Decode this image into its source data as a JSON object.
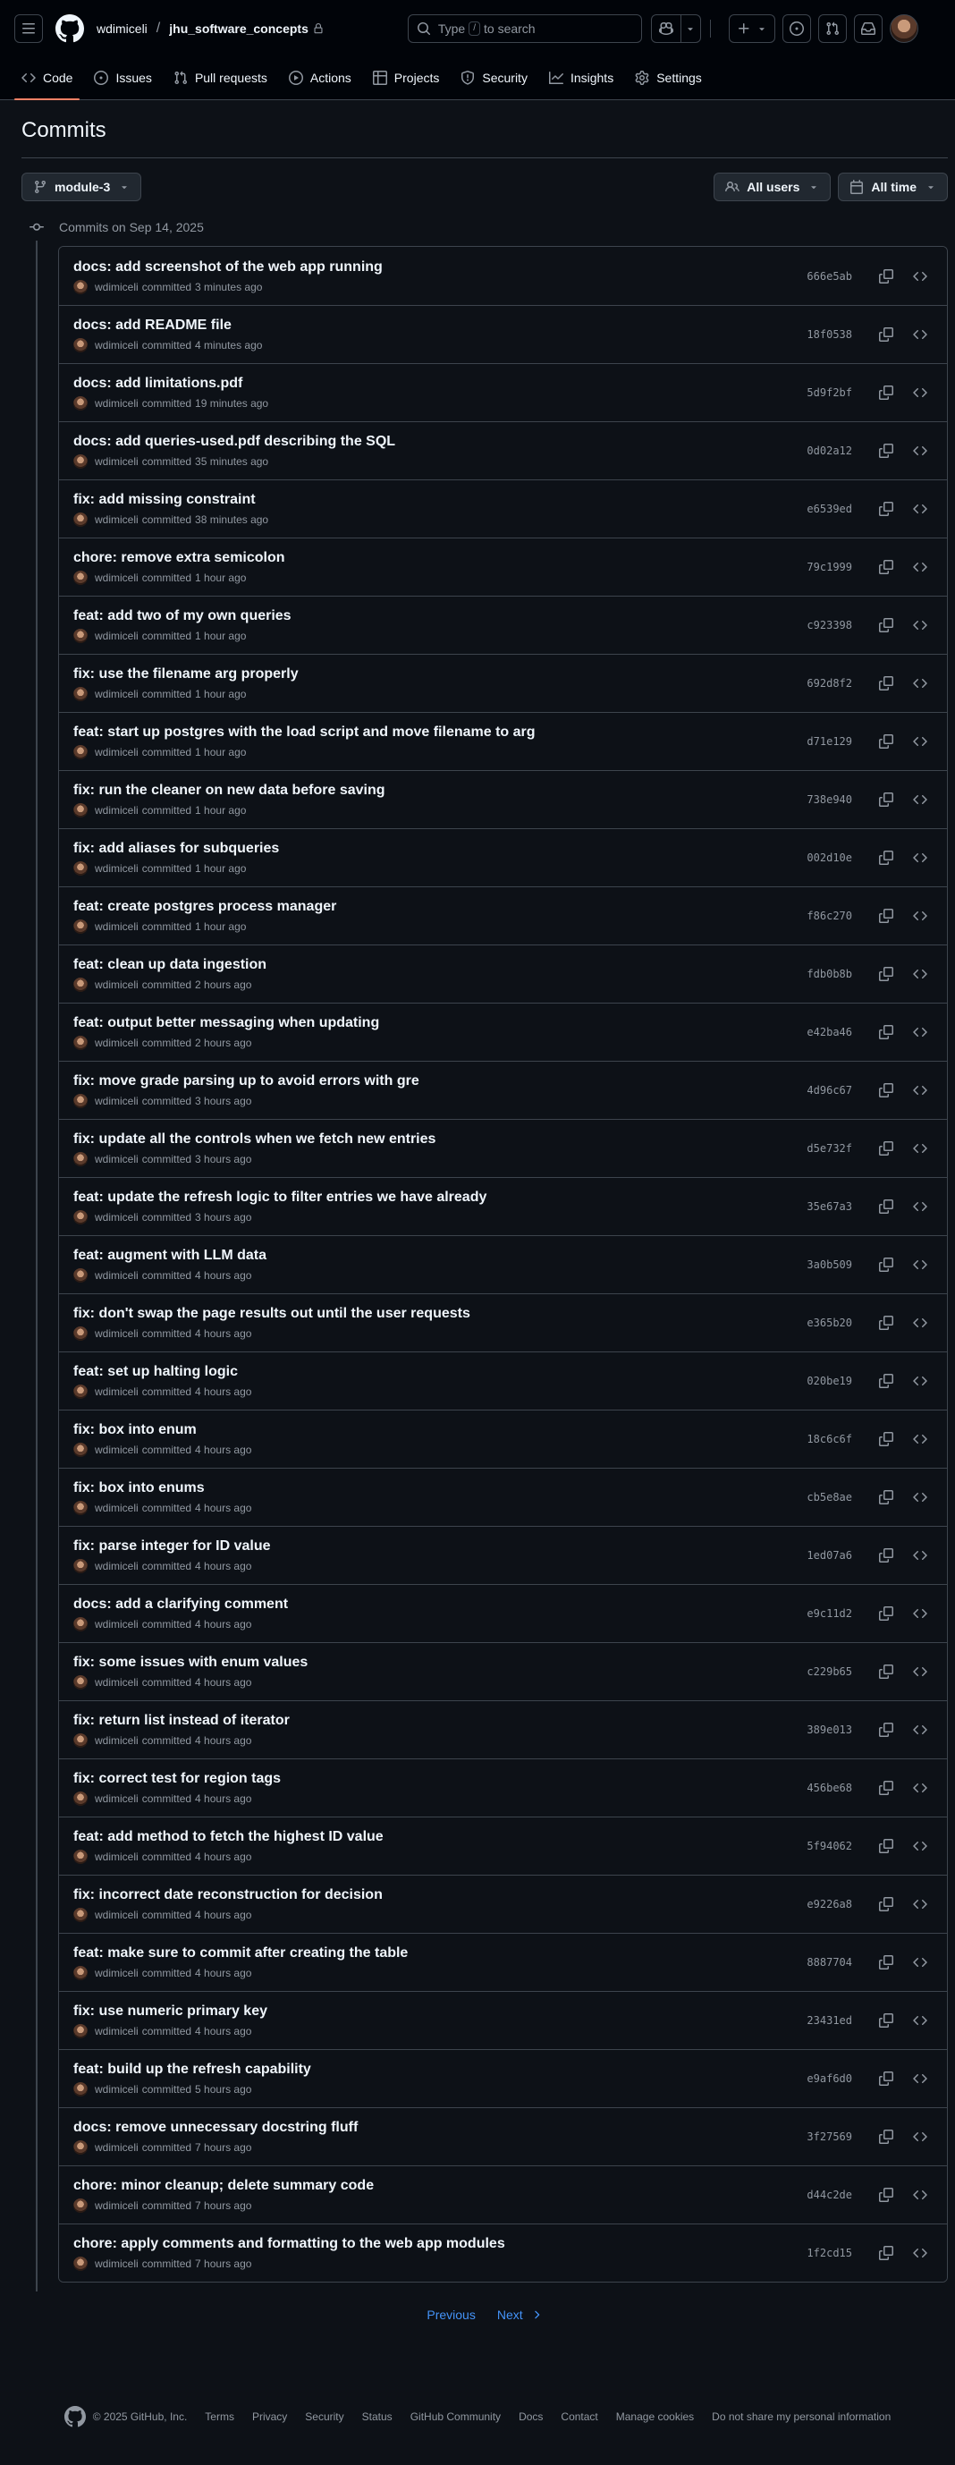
{
  "header": {
    "owner": "wdimiceli",
    "separator": "/",
    "repo": "jhu_software_concepts",
    "search_placeholder_pre": "Type",
    "search_key": "/",
    "search_placeholder_post": "to search"
  },
  "nav": {
    "tabs": [
      {
        "label": "Code",
        "icon": "code-icon"
      },
      {
        "label": "Issues",
        "icon": "issue-icon"
      },
      {
        "label": "Pull requests",
        "icon": "pull-request-icon"
      },
      {
        "label": "Actions",
        "icon": "play-icon"
      },
      {
        "label": "Projects",
        "icon": "table-icon"
      },
      {
        "label": "Security",
        "icon": "shield-icon"
      },
      {
        "label": "Insights",
        "icon": "graph-icon"
      },
      {
        "label": "Settings",
        "icon": "gear-icon"
      }
    ]
  },
  "page": {
    "title": "Commits",
    "branch": "module-3",
    "users_filter": "All users",
    "time_filter": "All time",
    "group_heading": "Commits on Sep 14, 2025"
  },
  "commits": [
    {
      "title": "docs: add screenshot of the web app running",
      "author": "wdimiceli",
      "action": "committed",
      "time": "3 minutes ago",
      "sha": "666e5ab"
    },
    {
      "title": "docs: add README file",
      "author": "wdimiceli",
      "action": "committed",
      "time": "4 minutes ago",
      "sha": "18f0538"
    },
    {
      "title": "docs: add limitations.pdf",
      "author": "wdimiceli",
      "action": "committed",
      "time": "19 minutes ago",
      "sha": "5d9f2bf"
    },
    {
      "title": "docs: add queries-used.pdf describing the SQL",
      "author": "wdimiceli",
      "action": "committed",
      "time": "35 minutes ago",
      "sha": "0d02a12"
    },
    {
      "title": "fix: add missing constraint",
      "author": "wdimiceli",
      "action": "committed",
      "time": "38 minutes ago",
      "sha": "e6539ed"
    },
    {
      "title": "chore: remove extra semicolon",
      "author": "wdimiceli",
      "action": "committed",
      "time": "1 hour ago",
      "sha": "79c1999"
    },
    {
      "title": "feat: add two of my own queries",
      "author": "wdimiceli",
      "action": "committed",
      "time": "1 hour ago",
      "sha": "c923398"
    },
    {
      "title": "fix: use the filename arg properly",
      "author": "wdimiceli",
      "action": "committed",
      "time": "1 hour ago",
      "sha": "692d8f2"
    },
    {
      "title": "feat: start up postgres with the load script and move filename to arg",
      "author": "wdimiceli",
      "action": "committed",
      "time": "1 hour ago",
      "sha": "d71e129"
    },
    {
      "title": "fix: run the cleaner on new data before saving",
      "author": "wdimiceli",
      "action": "committed",
      "time": "1 hour ago",
      "sha": "738e940"
    },
    {
      "title": "fix: add aliases for subqueries",
      "author": "wdimiceli",
      "action": "committed",
      "time": "1 hour ago",
      "sha": "002d10e"
    },
    {
      "title": "feat: create postgres process manager",
      "author": "wdimiceli",
      "action": "committed",
      "time": "1 hour ago",
      "sha": "f86c270"
    },
    {
      "title": "feat: clean up data ingestion",
      "author": "wdimiceli",
      "action": "committed",
      "time": "2 hours ago",
      "sha": "fdb0b8b"
    },
    {
      "title": "feat: output better messaging when updating",
      "author": "wdimiceli",
      "action": "committed",
      "time": "2 hours ago",
      "sha": "e42ba46"
    },
    {
      "title": "fix: move grade parsing up to avoid errors with gre",
      "author": "wdimiceli",
      "action": "committed",
      "time": "3 hours ago",
      "sha": "4d96c67"
    },
    {
      "title": "fix: update all the controls when we fetch new entries",
      "author": "wdimiceli",
      "action": "committed",
      "time": "3 hours ago",
      "sha": "d5e732f"
    },
    {
      "title": "feat: update the refresh logic to filter entries we have already",
      "author": "wdimiceli",
      "action": "committed",
      "time": "3 hours ago",
      "sha": "35e67a3"
    },
    {
      "title": "feat: augment with LLM data",
      "author": "wdimiceli",
      "action": "committed",
      "time": "4 hours ago",
      "sha": "3a0b509"
    },
    {
      "title": "fix: don't swap the page results out until the user requests",
      "author": "wdimiceli",
      "action": "committed",
      "time": "4 hours ago",
      "sha": "e365b20"
    },
    {
      "title": "feat: set up halting logic",
      "author": "wdimiceli",
      "action": "committed",
      "time": "4 hours ago",
      "sha": "020be19"
    },
    {
      "title": "fix: box into enum",
      "author": "wdimiceli",
      "action": "committed",
      "time": "4 hours ago",
      "sha": "18c6c6f"
    },
    {
      "title": "fix: box into enums",
      "author": "wdimiceli",
      "action": "committed",
      "time": "4 hours ago",
      "sha": "cb5e8ae"
    },
    {
      "title": "fix: parse integer for ID value",
      "author": "wdimiceli",
      "action": "committed",
      "time": "4 hours ago",
      "sha": "1ed07a6"
    },
    {
      "title": "docs: add a clarifying comment",
      "author": "wdimiceli",
      "action": "committed",
      "time": "4 hours ago",
      "sha": "e9c11d2"
    },
    {
      "title": "fix: some issues with enum values",
      "author": "wdimiceli",
      "action": "committed",
      "time": "4 hours ago",
      "sha": "c229b65"
    },
    {
      "title": "fix: return list instead of iterator",
      "author": "wdimiceli",
      "action": "committed",
      "time": "4 hours ago",
      "sha": "389e013"
    },
    {
      "title": "fix: correct test for region tags",
      "author": "wdimiceli",
      "action": "committed",
      "time": "4 hours ago",
      "sha": "456be68"
    },
    {
      "title": "feat: add method to fetch the highest ID value",
      "author": "wdimiceli",
      "action": "committed",
      "time": "4 hours ago",
      "sha": "5f94062"
    },
    {
      "title": "fix: incorrect date reconstruction for decision",
      "author": "wdimiceli",
      "action": "committed",
      "time": "4 hours ago",
      "sha": "e9226a8"
    },
    {
      "title": "feat: make sure to commit after creating the table",
      "author": "wdimiceli",
      "action": "committed",
      "time": "4 hours ago",
      "sha": "8887704"
    },
    {
      "title": "fix: use numeric primary key",
      "author": "wdimiceli",
      "action": "committed",
      "time": "4 hours ago",
      "sha": "23431ed"
    },
    {
      "title": "feat: build up the refresh capability",
      "author": "wdimiceli",
      "action": "committed",
      "time": "5 hours ago",
      "sha": "e9af6d0"
    },
    {
      "title": "docs: remove unnecessary docstring fluff",
      "author": "wdimiceli",
      "action": "committed",
      "time": "7 hours ago",
      "sha": "3f27569"
    },
    {
      "title": "chore: minor cleanup; delete summary code",
      "author": "wdimiceli",
      "action": "committed",
      "time": "7 hours ago",
      "sha": "d44c2de"
    },
    {
      "title": "chore: apply comments and formatting to the web app modules",
      "author": "wdimiceli",
      "action": "committed",
      "time": "7 hours ago",
      "sha": "1f2cd15"
    }
  ],
  "pagination": {
    "previous": "Previous",
    "next": "Next"
  },
  "footer": {
    "copyright": "© 2025 GitHub, Inc.",
    "links": [
      "Terms",
      "Privacy",
      "Security",
      "Status",
      "GitHub Community",
      "Docs",
      "Contact",
      "Manage cookies",
      "Do not share my personal information"
    ]
  },
  "colors": {
    "background": "#0d1117",
    "header_bg": "#010409",
    "border": "#3d444d",
    "text": "#f0f6fc",
    "muted": "#9198a1",
    "link": "#4493f8",
    "tab_underline": "#f78166"
  }
}
